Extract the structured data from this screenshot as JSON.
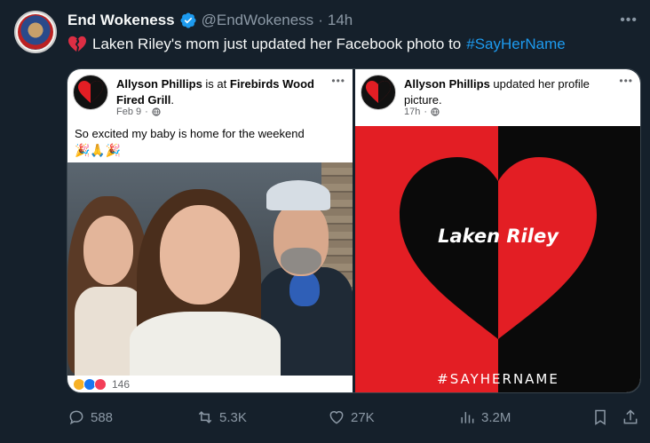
{
  "tweet": {
    "display_name": "End Wokeness",
    "handle": "@EndWokeness",
    "separator": "·",
    "time": "14h",
    "more_icon": "more-horizontal-icon",
    "text_main": "Laken Riley's mom just updated her Facebook photo to",
    "hashtag": "#SayHerName",
    "colors": {
      "background": "#15202b",
      "hashtag": "#1d9bf0",
      "verified": "#1d9bf0",
      "muted": "#8b98a5"
    }
  },
  "fb_post_left": {
    "author": "Allyson Phillips",
    "is_at": "is at",
    "place": "Firebirds Wood Fired Grill",
    "period": ".",
    "date": "Feb 9",
    "separator": "·",
    "text": "So excited my baby is home for the weekend",
    "emojis": "🎉🙏🎉",
    "reaction_count": "146"
  },
  "fb_post_right": {
    "author": "Allyson Phillips",
    "action": "updated her profile picture.",
    "time": "17h",
    "separator": "·",
    "poster_title": "Laken Riley",
    "poster_tag": "#SAYHERNAME",
    "colors": {
      "red": "#e31e24",
      "black": "#0a0a0a"
    }
  },
  "actions": {
    "replies": "588",
    "retweets": "5.3K",
    "likes": "27K",
    "views": "3.2M"
  }
}
